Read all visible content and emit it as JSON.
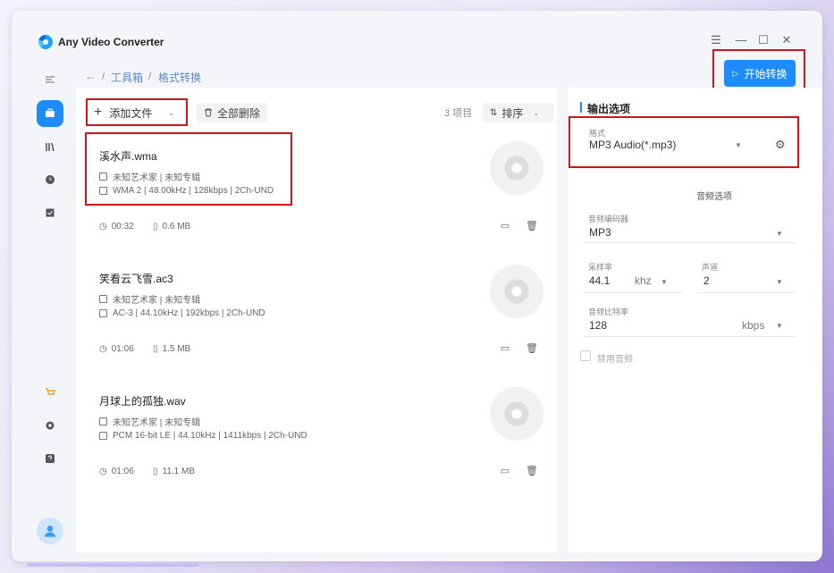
{
  "app": {
    "title": "Any Video Converter"
  },
  "window_controls": {
    "menu": "☰",
    "minimize": "—",
    "maximize": "☐",
    "close": "✕"
  },
  "breadcrumb": {
    "back": "←",
    "sep": "/",
    "toolbox": "工具箱",
    "current": "格式转换"
  },
  "toolbar": {
    "start_label": "开始转换",
    "add_label": "添加文件",
    "delete_all_label": "全部删除",
    "count_label": "3 项目",
    "sort_label": "排序"
  },
  "files": [
    {
      "name": "溪水声.wma",
      "artist_album": "未知艺术家 | 未知专辑",
      "codec_info": "WMA 2 | 48.00kHz | 128kbps | 2Ch-UND",
      "duration": "00:32",
      "size": "0.6 MB"
    },
    {
      "name": "笑看云飞雪.ac3",
      "artist_album": "未知艺术家 | 未知专辑",
      "codec_info": "AC-3 | 44.10kHz | 192kbps | 2Ch-UND",
      "duration": "01:06",
      "size": "1.5 MB"
    },
    {
      "name": "月球上的孤独.wav",
      "artist_album": "未知艺术家 | 未知专辑",
      "codec_info": "PCM 16-bit LE | 44.10kHz | 1411kbps | 2Ch-UND",
      "duration": "01:06",
      "size": "11.1 MB"
    }
  ],
  "output": {
    "section_title": "输出选项",
    "format_label": "格式",
    "format_value": "MP3 Audio(*.mp3)",
    "audio_options_title": "音频选项",
    "encoder_label": "音频编码器",
    "encoder_value": "MP3",
    "sample_rate_label": "采样率",
    "sample_rate_value": "44.1",
    "sample_rate_unit": "khz",
    "channels_label": "声道",
    "channels_value": "2",
    "bitrate_label": "音频比特率",
    "bitrate_value": "128",
    "bitrate_unit": "kbps",
    "disable_audio_label": "禁用音频"
  },
  "colors": {
    "accent": "#1e8cff",
    "highlight": "#d0141b"
  }
}
